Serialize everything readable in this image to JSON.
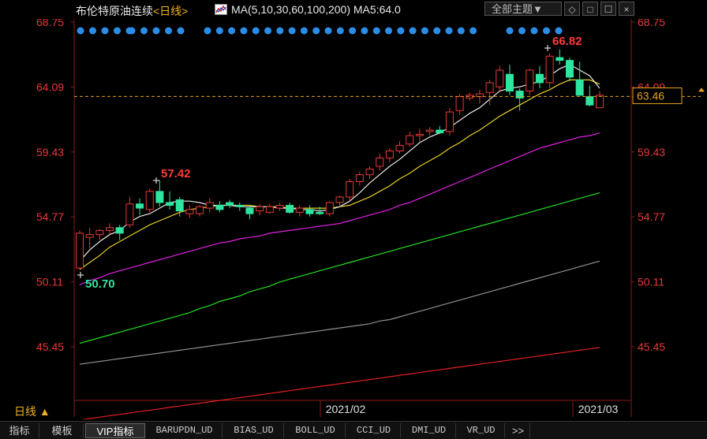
{
  "header": {
    "title": "布伦特原油连续",
    "period_label": "<日线>",
    "ma_label": "MA(5,10,30,60,100,200)",
    "ma5_label": "MA5:64.0",
    "dropdown_label": "全部主题▼",
    "buttons": [
      "◇",
      "□",
      "☐",
      "×"
    ]
  },
  "chart_data": {
    "type": "candlestick",
    "y_ticks": [
      "68.75",
      "64.09",
      "59.43",
      "54.77",
      "50.11",
      "45.45"
    ],
    "x_ticks": [
      "2021/02",
      "2021/03"
    ],
    "high_label": "66.82",
    "low_label": "50.70",
    "peak_label": "57.42",
    "last_price": "63.46",
    "ylim": [
      45.45,
      68.75
    ],
    "colors": {
      "up": "#e83838",
      "down": "#2ee5a0",
      "ma5": "#e8e8e8",
      "ma10": "#e8d020",
      "ma30": "#e020e0",
      "ma60": "#20e020",
      "ma100": "#909090",
      "ma200": "#e02020"
    },
    "candles": [
      [
        51.1,
        53.8,
        51.0,
        53.6
      ],
      [
        53.3,
        54.0,
        52.5,
        53.5
      ],
      [
        53.5,
        53.9,
        53.1,
        53.8
      ],
      [
        53.8,
        54.3,
        53.5,
        54.0
      ],
      [
        54.0,
        54.2,
        53.1,
        53.6
      ],
      [
        54.2,
        56.2,
        54.0,
        55.7
      ],
      [
        55.7,
        56.1,
        54.9,
        55.4
      ],
      [
        55.3,
        56.8,
        55.1,
        56.6
      ],
      [
        56.6,
        57.4,
        55.5,
        55.8
      ],
      [
        55.8,
        56.6,
        55.3,
        55.6
      ],
      [
        56.0,
        56.2,
        54.8,
        55.2
      ],
      [
        55.0,
        55.6,
        54.7,
        55.3
      ],
      [
        55.0,
        55.6,
        54.8,
        55.5
      ],
      [
        55.4,
        56.1,
        55.1,
        55.8
      ],
      [
        55.6,
        55.9,
        55.1,
        55.3
      ],
      [
        55.8,
        56.0,
        55.4,
        55.6
      ],
      [
        55.6,
        55.8,
        55.2,
        55.5
      ],
      [
        55.4,
        55.6,
        54.6,
        55.0
      ],
      [
        55.2,
        55.7,
        54.9,
        55.5
      ],
      [
        55.1,
        55.7,
        55.0,
        55.5
      ],
      [
        55.4,
        55.8,
        55.2,
        55.6
      ],
      [
        55.6,
        55.8,
        55.0,
        55.1
      ],
      [
        55.1,
        55.6,
        54.8,
        55.4
      ],
      [
        55.3,
        55.6,
        54.8,
        55.0
      ],
      [
        55.1,
        55.5,
        54.9,
        55.0
      ],
      [
        55.0,
        55.9,
        54.8,
        55.8
      ],
      [
        55.8,
        56.3,
        55.5,
        56.2
      ],
      [
        56.2,
        57.5,
        55.9,
        57.3
      ],
      [
        57.3,
        58.0,
        57.0,
        57.8
      ],
      [
        57.8,
        58.4,
        57.5,
        58.2
      ],
      [
        58.4,
        59.3,
        58.1,
        59.0
      ],
      [
        59.0,
        59.7,
        58.7,
        59.5
      ],
      [
        59.5,
        60.2,
        59.3,
        59.9
      ],
      [
        60.0,
        60.9,
        59.8,
        60.6
      ],
      [
        60.6,
        61.1,
        60.1,
        60.7
      ],
      [
        60.9,
        61.2,
        60.6,
        61.0
      ],
      [
        61.0,
        61.3,
        60.7,
        60.8
      ],
      [
        60.9,
        62.6,
        60.6,
        62.3
      ],
      [
        62.4,
        63.6,
        62.1,
        63.4
      ],
      [
        63.3,
        63.7,
        63.1,
        63.5
      ],
      [
        63.4,
        63.9,
        62.9,
        63.6
      ],
      [
        63.7,
        64.6,
        62.8,
        64.4
      ],
      [
        64.1,
        65.6,
        63.7,
        65.3
      ],
      [
        65.0,
        65.7,
        63.5,
        63.8
      ],
      [
        63.8,
        64.0,
        62.4,
        63.3
      ],
      [
        63.8,
        65.4,
        63.5,
        65.3
      ],
      [
        65.0,
        65.6,
        64.0,
        64.4
      ],
      [
        64.4,
        66.5,
        64.0,
        66.3
      ],
      [
        66.2,
        66.8,
        65.7,
        66.0
      ],
      [
        66.0,
        66.2,
        64.5,
        64.8
      ],
      [
        64.6,
        65.9,
        63.5,
        63.5
      ],
      [
        63.4,
        64.2,
        62.7,
        62.8
      ],
      [
        62.6,
        63.8,
        62.6,
        63.5
      ]
    ],
    "ma5": [
      51.6,
      52.4,
      53.0,
      53.5,
      53.8,
      54.4,
      54.8,
      55.0,
      55.4,
      55.8,
      55.9,
      55.9,
      55.8,
      55.6,
      55.6,
      55.6,
      55.5,
      55.5,
      55.5,
      55.5,
      55.4,
      55.4,
      55.3,
      55.3,
      55.2,
      55.3,
      55.5,
      55.9,
      56.5,
      57.2,
      57.8,
      58.4,
      58.9,
      59.5,
      60.1,
      60.5,
      60.8,
      61.2,
      61.7,
      62.2,
      62.6,
      63.2,
      63.8,
      64.0,
      64.1,
      64.3,
      64.5,
      64.9,
      65.4,
      65.7,
      65.3,
      64.9,
      64.0
    ],
    "ma10": [
      51.0,
      51.5,
      52.0,
      52.6,
      53.0,
      53.4,
      53.8,
      54.2,
      54.5,
      54.8,
      55.1,
      55.3,
      55.4,
      55.5,
      55.6,
      55.6,
      55.6,
      55.6,
      55.5,
      55.5,
      55.5,
      55.4,
      55.4,
      55.4,
      55.4,
      55.4,
      55.5,
      55.6,
      55.9,
      56.2,
      56.6,
      57.0,
      57.5,
      57.9,
      58.4,
      58.8,
      59.2,
      59.7,
      60.1,
      60.6,
      61.0,
      61.5,
      62.0,
      62.4,
      62.8,
      63.2,
      63.6,
      63.9,
      64.3,
      64.6,
      64.6,
      64.6,
      64.3
    ],
    "ma30": [
      49.9,
      50.2,
      50.4,
      50.7,
      50.9,
      51.1,
      51.3,
      51.5,
      51.7,
      51.9,
      52.1,
      52.3,
      52.5,
      52.7,
      52.9,
      53.0,
      53.2,
      53.3,
      53.4,
      53.6,
      53.7,
      53.8,
      53.9,
      54.0,
      54.1,
      54.2,
      54.3,
      54.5,
      54.7,
      54.9,
      55.1,
      55.3,
      55.6,
      55.8,
      56.1,
      56.4,
      56.7,
      57.0,
      57.3,
      57.6,
      57.9,
      58.2,
      58.5,
      58.8,
      59.1,
      59.4,
      59.7,
      59.9,
      60.1,
      60.3,
      60.5,
      60.6,
      60.8
    ],
    "ma60": [
      45.7,
      45.9,
      46.1,
      46.3,
      46.5,
      46.7,
      46.9,
      47.1,
      47.3,
      47.5,
      47.7,
      47.9,
      48.2,
      48.4,
      48.7,
      48.9,
      49.1,
      49.4,
      49.6,
      49.8,
      50.1,
      50.3,
      50.5,
      50.7,
      50.9,
      51.1,
      51.3,
      51.5,
      51.7,
      51.9,
      52.1,
      52.3,
      52.5,
      52.7,
      52.9,
      53.1,
      53.3,
      53.5,
      53.7,
      53.9,
      54.1,
      54.3,
      54.5,
      54.7,
      54.9,
      55.1,
      55.3,
      55.5,
      55.7,
      55.9,
      56.1,
      56.3,
      56.5
    ],
    "ma100": [
      44.2,
      44.3,
      44.4,
      44.5,
      44.6,
      44.7,
      44.8,
      44.9,
      45.0,
      45.1,
      45.2,
      45.3,
      45.4,
      45.5,
      45.6,
      45.7,
      45.8,
      45.9,
      46.0,
      46.1,
      46.2,
      46.3,
      46.4,
      46.5,
      46.6,
      46.7,
      46.8,
      46.9,
      47.0,
      47.1,
      47.3,
      47.4,
      47.6,
      47.8,
      48.0,
      48.2,
      48.4,
      48.6,
      48.8,
      49.0,
      49.2,
      49.4,
      49.6,
      49.8,
      50.0,
      50.2,
      50.4,
      50.6,
      50.8,
      51.0,
      51.2,
      51.4,
      51.6
    ],
    "ma200": [
      40.2,
      40.3,
      40.4,
      40.5,
      40.6,
      40.7,
      40.8,
      40.9,
      41.0,
      41.1,
      41.2,
      41.3,
      41.4,
      41.5,
      41.6,
      41.7,
      41.8,
      41.9,
      42.0,
      42.1,
      42.2,
      42.3,
      42.4,
      42.5,
      42.6,
      42.7,
      42.8,
      42.9,
      43.0,
      43.1,
      43.2,
      43.3,
      43.4,
      43.5,
      43.6,
      43.7,
      43.8,
      43.9,
      44.0,
      44.1,
      44.2,
      44.3,
      44.4,
      44.5,
      44.6,
      44.7,
      44.8,
      44.9,
      45.0,
      45.1,
      45.2,
      45.3,
      45.4
    ]
  },
  "bottom": {
    "period_button": "日线 ▲"
  },
  "tabs": [
    "指标",
    "模板",
    "VIP指标",
    "BARUPDN_UD",
    "BIAS_UD",
    "BOLL_UD",
    "CCI_UD",
    "DMI_UD",
    "VR_UD",
    ">>"
  ]
}
